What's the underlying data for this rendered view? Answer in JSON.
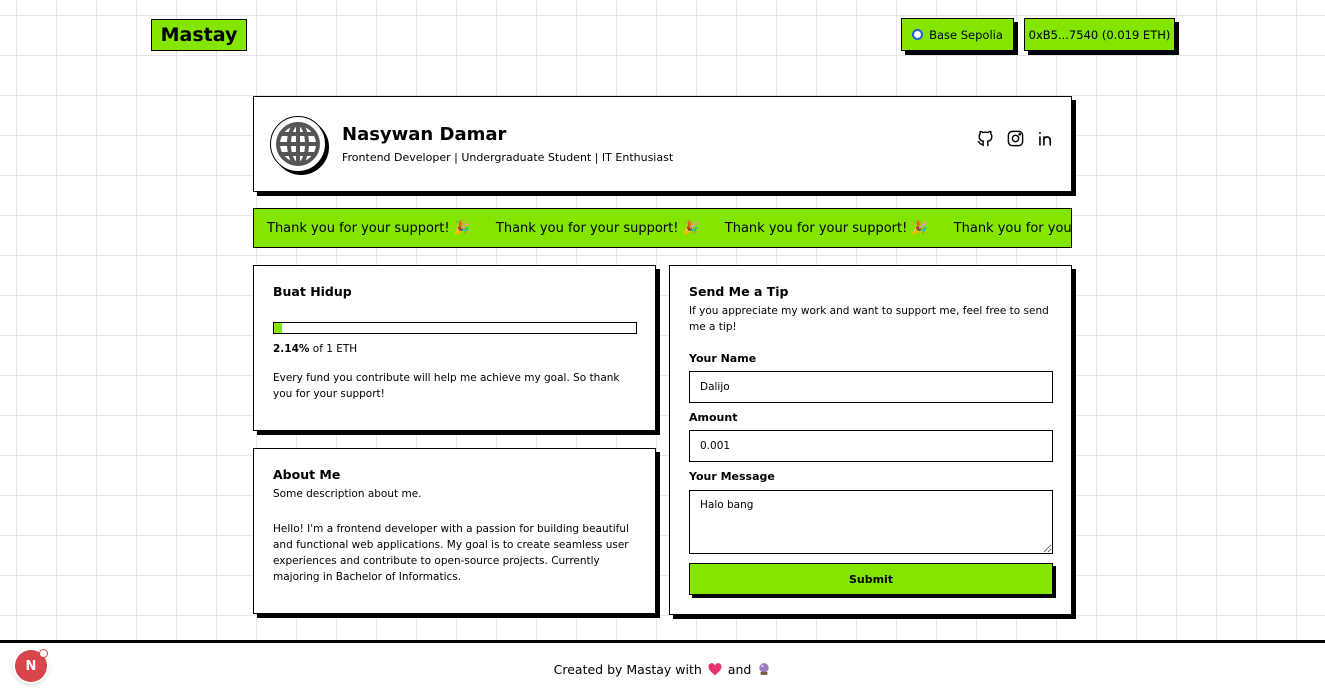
{
  "header": {
    "logo": "Mastay",
    "network": "Base Sepolia",
    "wallet": "0xB5...7540 (0.019 ETH)"
  },
  "profile": {
    "name": "Nasywan Damar",
    "role": "Frontend Developer | Undergraduate Student | IT Enthusiast",
    "socials": [
      "github-icon",
      "instagram-icon",
      "linkedin-icon"
    ]
  },
  "marquee": {
    "message": "Thank you for your support! 🎉"
  },
  "goal": {
    "title": "Buat Hidup",
    "percent": "2.14%",
    "progress_fraction": 0.0214,
    "target": "of 1 ETH",
    "description": "Every fund you contribute will help me achieve my goal. So thank you for your support!"
  },
  "about": {
    "title": "About Me",
    "subtitle": "Some description about me.",
    "body": "Hello! I'm a frontend developer with a passion for building beautiful and functional web applications. My goal is to create seamless user experiences and contribute to open-source projects. Currently majoring in Bachelor of Informatics."
  },
  "tip": {
    "title": "Send Me a Tip",
    "description": "If you appreciate my work and want to support me, feel free to send me a tip!",
    "name_label": "Your Name",
    "name_value": "Dalijo",
    "amount_label": "Amount",
    "amount_value": "0.001",
    "message_label": "Your Message",
    "message_value": "Halo bang",
    "submit_label": "Submit"
  },
  "footer": {
    "text": "Created by Mastay with",
    "and": "and",
    "badge": "N"
  },
  "colors": {
    "accent": "#84e600",
    "border": "#000000",
    "badge": "#d8454a"
  }
}
